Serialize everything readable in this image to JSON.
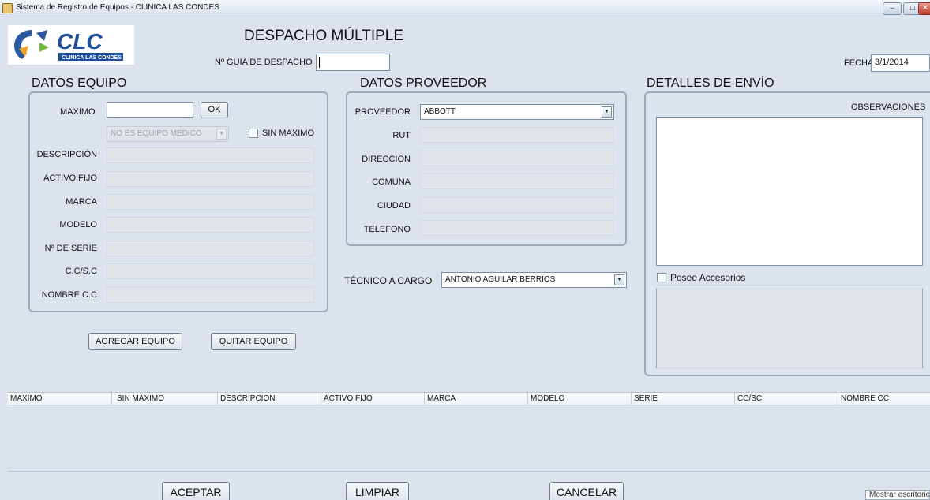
{
  "window": {
    "title": "Sistema de Registro de Equipos - CLINICA LAS CONDES",
    "minimize_label": "–",
    "maximize_label": "□",
    "close_label": "✕"
  },
  "logo": {
    "text": "CLC",
    "subtext": "CLINICA LAS CONDES"
  },
  "header": {
    "title": "DESPACHO MÚLTIPLE",
    "guia_label": "Nº GUIA DE DESPACHO",
    "guia_value": "",
    "fecha_label": "FECHA",
    "fecha_value": "3/1/2014"
  },
  "datos_equipo": {
    "heading": "DATOS EQUIPO",
    "maximo_label": "MAXIMO",
    "maximo_value": "",
    "ok_label": "OK",
    "equipo_select": "NO ES EQUIPO MEDICO",
    "sin_maximo_label": "SIN MAXIMO",
    "descripcion_label": "DESCRIPCIÓN",
    "activo_fijo_label": "ACTIVO FIJO",
    "marca_label": "MARCA",
    "modelo_label": "MODELO",
    "serie_label": "Nº DE SERIE",
    "ccsc_label": "C.C/S.C",
    "nombre_cc_label": "NOMBRE C.C",
    "agregar_label": "AGREGAR EQUIPO",
    "quitar_label": "QUITAR EQUIPO"
  },
  "datos_proveedor": {
    "heading": "DATOS PROVEEDOR",
    "proveedor_label": "PROVEEDOR",
    "proveedor_value": "ABBOTT",
    "rut_label": "RUT",
    "direccion_label": "DIRECCION",
    "comuna_label": "COMUNA",
    "ciudad_label": "CIUDAD",
    "telefono_label": "TELEFONO",
    "tecnico_label": "TÉCNICO A CARGO",
    "tecnico_value": "ANTONIO AGUILAR BERRIOS"
  },
  "detalles_envio": {
    "heading": "DETALLES DE ENVÍO",
    "observaciones_label": "OBSERVACIONES",
    "accesorios_label": "Posee Accesorios"
  },
  "table": {
    "columns": [
      "MAXIMO",
      "SIN MAXIMO",
      "DESCRIPCION",
      "ACTIVO FIJO",
      "MARCA",
      "MODELO",
      "SERIE",
      "CC/SC",
      "NOMBRE CC"
    ]
  },
  "footer": {
    "aceptar_label": "ACEPTAR",
    "limpiar_label": "LIMPIAR",
    "cancelar_label": "CANCELAR",
    "mostrar_escritorio": "Mostrar escritorio"
  },
  "icons": {
    "dropdown": "▼"
  }
}
